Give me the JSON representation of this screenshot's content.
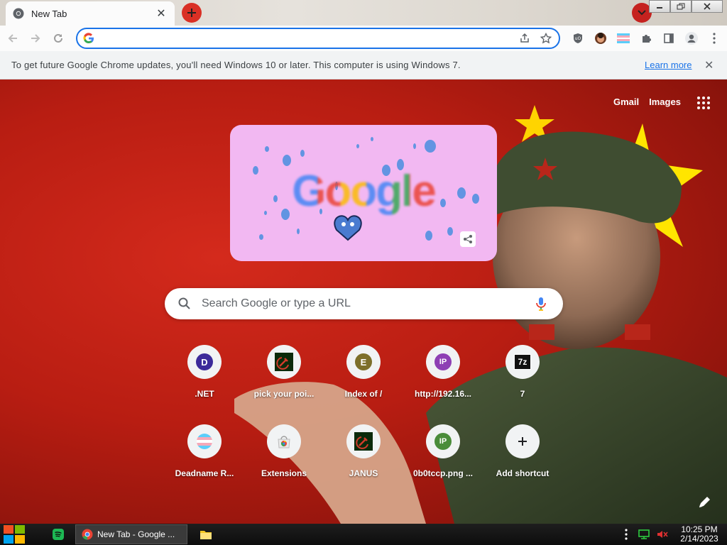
{
  "tab": {
    "title": "New Tab",
    "close": "✕"
  },
  "toolbar": {
    "omnibox_value": "",
    "omnibox_placeholder": ""
  },
  "infobar": {
    "message": "To get future Google Chrome updates, you'll need Windows 10 or later. This computer is using Windows 7.",
    "learn_more": "Learn more",
    "close": "✕"
  },
  "ntp": {
    "gmail": "Gmail",
    "images": "Images",
    "doodle_text": "Google",
    "search_placeholder": "Search Google or type a URL",
    "shortcuts": [
      {
        "label": ".NET",
        "icon": "letter",
        "letter": "D",
        "color": "#3c2a9a"
      },
      {
        "label": "pick your poi...",
        "icon": "hammer-sickle-icon",
        "letter": "",
        "color": "#0b2a0b"
      },
      {
        "label": "Index of /",
        "icon": "letter",
        "letter": "E",
        "color": "#7d6f2a"
      },
      {
        "label": "http://192.16...",
        "icon": "letter",
        "letter": "IP",
        "color": "#8e3fb4"
      },
      {
        "label": "7",
        "icon": "7zip-icon",
        "letter": "7z",
        "color": "#111111"
      },
      {
        "label": "Deadname R...",
        "icon": "trans-flag-icon",
        "letter": "",
        "color": "#5bcefa"
      },
      {
        "label": "Extensions",
        "icon": "chrome-web-store-icon",
        "letter": "",
        "color": "#e8e8e8"
      },
      {
        "label": "JANUS",
        "icon": "hammer-sickle-icon",
        "letter": "",
        "color": "#0b2a0b"
      },
      {
        "label": "0b0tccp.png ...",
        "icon": "letter",
        "letter": "IP",
        "color": "#4a8c3a"
      },
      {
        "label": "Add shortcut",
        "icon": "plus-icon",
        "letter": "+",
        "color": "#202124"
      }
    ]
  },
  "taskbar": {
    "task_title": "New Tab - Google ...",
    "time": "10:25 PM",
    "date": "2/14/2023"
  },
  "colors": {
    "accent": "#1a73e8",
    "background_red": "#c42418",
    "doodle_bg": "#f2b8f2"
  }
}
